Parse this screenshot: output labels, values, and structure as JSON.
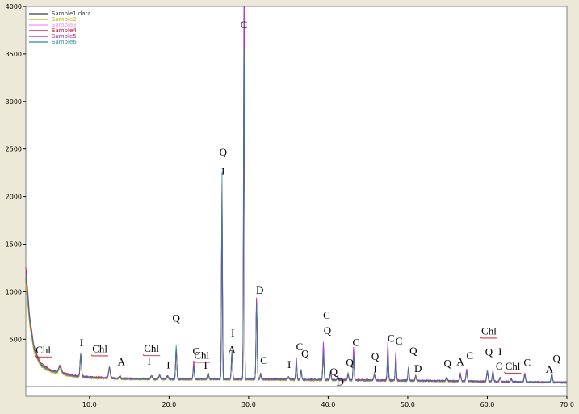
{
  "chart_data": {
    "type": "line",
    "title": "",
    "xlabel": "",
    "ylabel": "",
    "xlim": [
      2,
      70
    ],
    "ylim": [
      -100,
      4000
    ],
    "x_ticks": [
      {
        "v": 10,
        "label": "10.0"
      },
      {
        "v": 20,
        "label": "20.0"
      },
      {
        "v": 30,
        "label": "30.0"
      },
      {
        "v": 40,
        "label": "40.0"
      },
      {
        "v": 50,
        "label": "50.0"
      },
      {
        "v": 60,
        "label": "60.0"
      },
      {
        "v": 70,
        "label": "70.0"
      }
    ],
    "y_ticks": [
      {
        "v": 500,
        "label": "500"
      },
      {
        "v": 1000,
        "label": "1000"
      },
      {
        "v": 1500,
        "label": "1500"
      },
      {
        "v": 2000,
        "label": "2000"
      },
      {
        "v": 2500,
        "label": "2500"
      },
      {
        "v": 3000,
        "label": "3000"
      },
      {
        "v": 3500,
        "label": "3500"
      },
      {
        "v": 4000,
        "label": "4000"
      }
    ],
    "grid": false,
    "legend_position": "top-left",
    "series": [
      {
        "name": "Sample1 data",
        "color": "#3a3a3a",
        "scale": 0.95,
        "cscale": 1.05,
        "qscale": 0.9
      },
      {
        "name": "Sample2",
        "color": "#b8b800",
        "scale": 0.9,
        "cscale": 0.95,
        "qscale": 0.85
      },
      {
        "name": "Sample3",
        "color": "#ff88ff",
        "scale": 1.0,
        "cscale": 1.1,
        "qscale": 0.95
      },
      {
        "name": "Sample4",
        "color": "#c0002a",
        "scale": 1.05,
        "cscale": 0.9,
        "qscale": 0.8
      },
      {
        "name": "Sample5",
        "color": "#a020c0",
        "scale": 1.0,
        "cscale": 1.35,
        "qscale": 0.9
      },
      {
        "name": "Sample6",
        "color": "#2a8a9a",
        "scale": 1.0,
        "cscale": 1.0,
        "qscale": 1.0
      }
    ],
    "background": {
      "x": [
        2,
        2.5,
        3,
        3.5,
        4,
        5,
        6,
        8,
        10,
        14,
        20,
        30,
        40,
        50,
        60,
        70
      ],
      "y": [
        1200,
        700,
        420,
        300,
        230,
        175,
        150,
        115,
        100,
        85,
        80,
        80,
        72,
        65,
        55,
        45
      ]
    },
    "peaks": [
      {
        "x": 6.3,
        "h": 70,
        "w": 0.25,
        "phase": "Chl"
      },
      {
        "x": 8.9,
        "h": 230,
        "w": 0.12,
        "phase": "I"
      },
      {
        "x": 12.5,
        "h": 110,
        "w": 0.15,
        "phase": "Chl"
      },
      {
        "x": 13.8,
        "h": 25,
        "w": 0.15,
        "phase": "A"
      },
      {
        "x": 17.8,
        "h": 30,
        "w": 0.15,
        "phase": "I"
      },
      {
        "x": 18.8,
        "h": 40,
        "w": 0.15,
        "phase": "Chl"
      },
      {
        "x": 19.8,
        "h": 30,
        "w": 0.15,
        "phase": "I"
      },
      {
        "x": 20.9,
        "h": 360,
        "w": 0.1,
        "phase": "Q"
      },
      {
        "x": 23.1,
        "h": 140,
        "w": 0.1,
        "phase": "C"
      },
      {
        "x": 24.9,
        "h": 60,
        "w": 0.12,
        "phase": "Chl"
      },
      {
        "x": 26.65,
        "h": 2180,
        "w": 0.08,
        "phase": "Q"
      },
      {
        "x": 27.9,
        "h": 280,
        "w": 0.1,
        "phase": "A"
      },
      {
        "x": 29.42,
        "h": 3720,
        "w": 0.08,
        "phase": "C"
      },
      {
        "x": 31.0,
        "h": 820,
        "w": 0.1,
        "phase": "D"
      },
      {
        "x": 31.5,
        "h": 50,
        "w": 0.1,
        "phase": "C"
      },
      {
        "x": 35.0,
        "h": 25,
        "w": 0.15,
        "phase": "I"
      },
      {
        "x": 36.0,
        "h": 180,
        "w": 0.1,
        "phase": "C"
      },
      {
        "x": 36.6,
        "h": 110,
        "w": 0.1,
        "phase": "Q"
      },
      {
        "x": 39.4,
        "h": 300,
        "w": 0.1,
        "phase": "C"
      },
      {
        "x": 40.3,
        "h": 90,
        "w": 0.1,
        "phase": "Q"
      },
      {
        "x": 41.2,
        "h": 40,
        "w": 0.1,
        "phase": "D"
      },
      {
        "x": 42.5,
        "h": 80,
        "w": 0.1,
        "phase": "Q"
      },
      {
        "x": 43.2,
        "h": 260,
        "w": 0.1,
        "phase": "C"
      },
      {
        "x": 45.8,
        "h": 60,
        "w": 0.12,
        "phase": "I"
      },
      {
        "x": 47.5,
        "h": 300,
        "w": 0.1,
        "phase": "C"
      },
      {
        "x": 48.5,
        "h": 230,
        "w": 0.1,
        "phase": "C"
      },
      {
        "x": 50.1,
        "h": 150,
        "w": 0.1,
        "phase": "Q"
      },
      {
        "x": 51.0,
        "h": 50,
        "w": 0.1,
        "phase": "D"
      },
      {
        "x": 54.9,
        "h": 40,
        "w": 0.12,
        "phase": "Q"
      },
      {
        "x": 56.6,
        "h": 60,
        "w": 0.12,
        "phase": "C"
      },
      {
        "x": 57.4,
        "h": 100,
        "w": 0.12,
        "phase": "C"
      },
      {
        "x": 60.0,
        "h": 120,
        "w": 0.12,
        "phase": "Q"
      },
      {
        "x": 60.7,
        "h": 90,
        "w": 0.12,
        "phase": "C"
      },
      {
        "x": 61.6,
        "h": 40,
        "w": 0.12,
        "phase": "I"
      },
      {
        "x": 63.0,
        "h": 30,
        "w": 0.12,
        "phase": "Chl"
      },
      {
        "x": 64.7,
        "h": 70,
        "w": 0.12,
        "phase": "C"
      },
      {
        "x": 68.1,
        "h": 100,
        "w": 0.12,
        "phase": "Q"
      }
    ],
    "annotations": [
      {
        "text": "Chl",
        "x": 4.2,
        "y": 352,
        "underline": true
      },
      {
        "text": "I",
        "x": 9.0,
        "y": 425,
        "underline": false
      },
      {
        "text": "Chl",
        "x": 11.3,
        "y": 363,
        "underline": true
      },
      {
        "text": "A",
        "x": 14.0,
        "y": 225,
        "underline": false
      },
      {
        "text": "I",
        "x": 17.5,
        "y": 235,
        "underline": false
      },
      {
        "text": "Chl",
        "x": 17.8,
        "y": 365,
        "underline": true
      },
      {
        "text": "I",
        "x": 19.9,
        "y": 193,
        "underline": false
      },
      {
        "text": "Q",
        "x": 20.9,
        "y": 685,
        "underline": false
      },
      {
        "text": "C",
        "x": 23.4,
        "y": 338,
        "underline": false
      },
      {
        "text": "Chl",
        "x": 24.1,
        "y": 295,
        "underline": true
      },
      {
        "text": "I",
        "x": 24.6,
        "y": 187,
        "underline": false
      },
      {
        "text": "Q",
        "x": 26.8,
        "y": 2430,
        "underline": false
      },
      {
        "text": "I",
        "x": 26.8,
        "y": 2230,
        "underline": false
      },
      {
        "text": "I",
        "x": 28.0,
        "y": 530,
        "underline": false
      },
      {
        "text": "A",
        "x": 27.9,
        "y": 355,
        "underline": false
      },
      {
        "text": "C",
        "x": 29.4,
        "y": 3770,
        "underline": false
      },
      {
        "text": "D",
        "x": 31.4,
        "y": 980,
        "underline": false
      },
      {
        "text": "C",
        "x": 31.9,
        "y": 238,
        "underline": false
      },
      {
        "text": "I",
        "x": 35.1,
        "y": 197,
        "underline": false
      },
      {
        "text": "C",
        "x": 36.4,
        "y": 385,
        "underline": false
      },
      {
        "text": "Q",
        "x": 37.1,
        "y": 310,
        "underline": false
      },
      {
        "text": "C",
        "x": 39.8,
        "y": 715,
        "underline": false
      },
      {
        "text": "Q",
        "x": 39.9,
        "y": 555,
        "underline": false
      },
      {
        "text": "Q",
        "x": 40.7,
        "y": 120,
        "underline": false
      },
      {
        "text": "D",
        "x": 41.5,
        "y": 15,
        "underline": false
      },
      {
        "text": "Q",
        "x": 42.7,
        "y": 220,
        "underline": false
      },
      {
        "text": "C",
        "x": 43.5,
        "y": 430,
        "underline": false
      },
      {
        "text": "Q",
        "x": 45.9,
        "y": 280,
        "underline": false
      },
      {
        "text": "I",
        "x": 45.9,
        "y": 150,
        "underline": false
      },
      {
        "text": "C",
        "x": 47.9,
        "y": 475,
        "underline": false
      },
      {
        "text": "C",
        "x": 48.9,
        "y": 445,
        "underline": false
      },
      {
        "text": "Q",
        "x": 50.7,
        "y": 340,
        "underline": false
      },
      {
        "text": "D",
        "x": 51.3,
        "y": 155,
        "underline": false
      },
      {
        "text": "Q",
        "x": 55.0,
        "y": 210,
        "underline": false
      },
      {
        "text": "A",
        "x": 56.6,
        "y": 225,
        "underline": false
      },
      {
        "text": "C",
        "x": 57.8,
        "y": 290,
        "underline": false
      },
      {
        "text": "Chl",
        "x": 60.2,
        "y": 550,
        "underline": true
      },
      {
        "text": "Q",
        "x": 60.2,
        "y": 330,
        "underline": false
      },
      {
        "text": "I",
        "x": 61.6,
        "y": 335,
        "underline": false
      },
      {
        "text": "C",
        "x": 61.5,
        "y": 180,
        "underline": false
      },
      {
        "text": "Chl",
        "x": 63.2,
        "y": 180,
        "underline": true
      },
      {
        "text": "C",
        "x": 65.0,
        "y": 220,
        "underline": false
      },
      {
        "text": "A",
        "x": 67.8,
        "y": 145,
        "underline": false
      },
      {
        "text": "Q",
        "x": 68.7,
        "y": 260,
        "underline": false
      }
    ]
  }
}
